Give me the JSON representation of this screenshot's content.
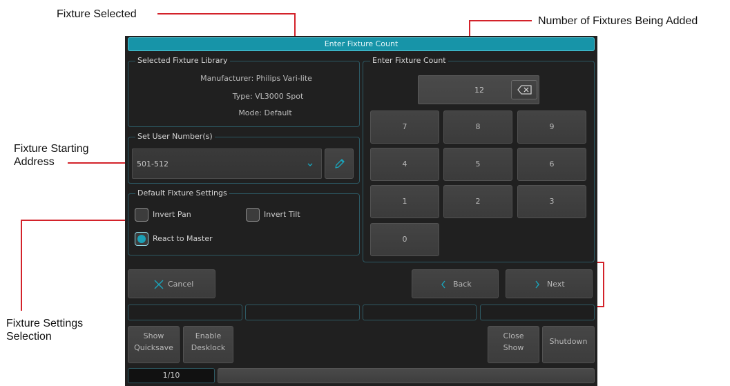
{
  "annotations": {
    "fixture_selected": "Fixture Selected",
    "fixtures_added": "Number of Fixtures Being Added",
    "start_address_line1": "Fixture Starting",
    "start_address_line2": "Address",
    "settings_line1": "Fixture Settings",
    "settings_line2": "Selection"
  },
  "window": {
    "title": "Enter Fixture Count"
  },
  "library": {
    "title": "Selected Fixture Library",
    "manufacturer": "Manufacturer: Philips Vari-lite",
    "type": "Type: VL3000 Spot",
    "mode": "Mode: Default"
  },
  "user_number": {
    "title": "Set User Number(s)",
    "value": "501-512"
  },
  "settings": {
    "title": "Default Fixture Settings",
    "invert_pan": "Invert Pan",
    "invert_tilt": "Invert Tilt",
    "react_master": "React to Master"
  },
  "count": {
    "title": "Enter Fixture Count",
    "value": "12",
    "keys": [
      "7",
      "8",
      "9",
      "4",
      "5",
      "6",
      "1",
      "2",
      "3",
      "0"
    ]
  },
  "actions": {
    "cancel": "Cancel",
    "back": "Back",
    "next": "Next"
  },
  "footer": {
    "show_quicksave_1": "Show",
    "show_quicksave_2": "Quicksave",
    "enable_desklock_1": "Enable",
    "enable_desklock_2": "Desklock",
    "close_show_1": "Close",
    "close_show_2": "Show",
    "shutdown": "Shutdown",
    "page": "1/10"
  },
  "colors": {
    "accent": "#1794a8",
    "annotation": "#d3222a"
  }
}
